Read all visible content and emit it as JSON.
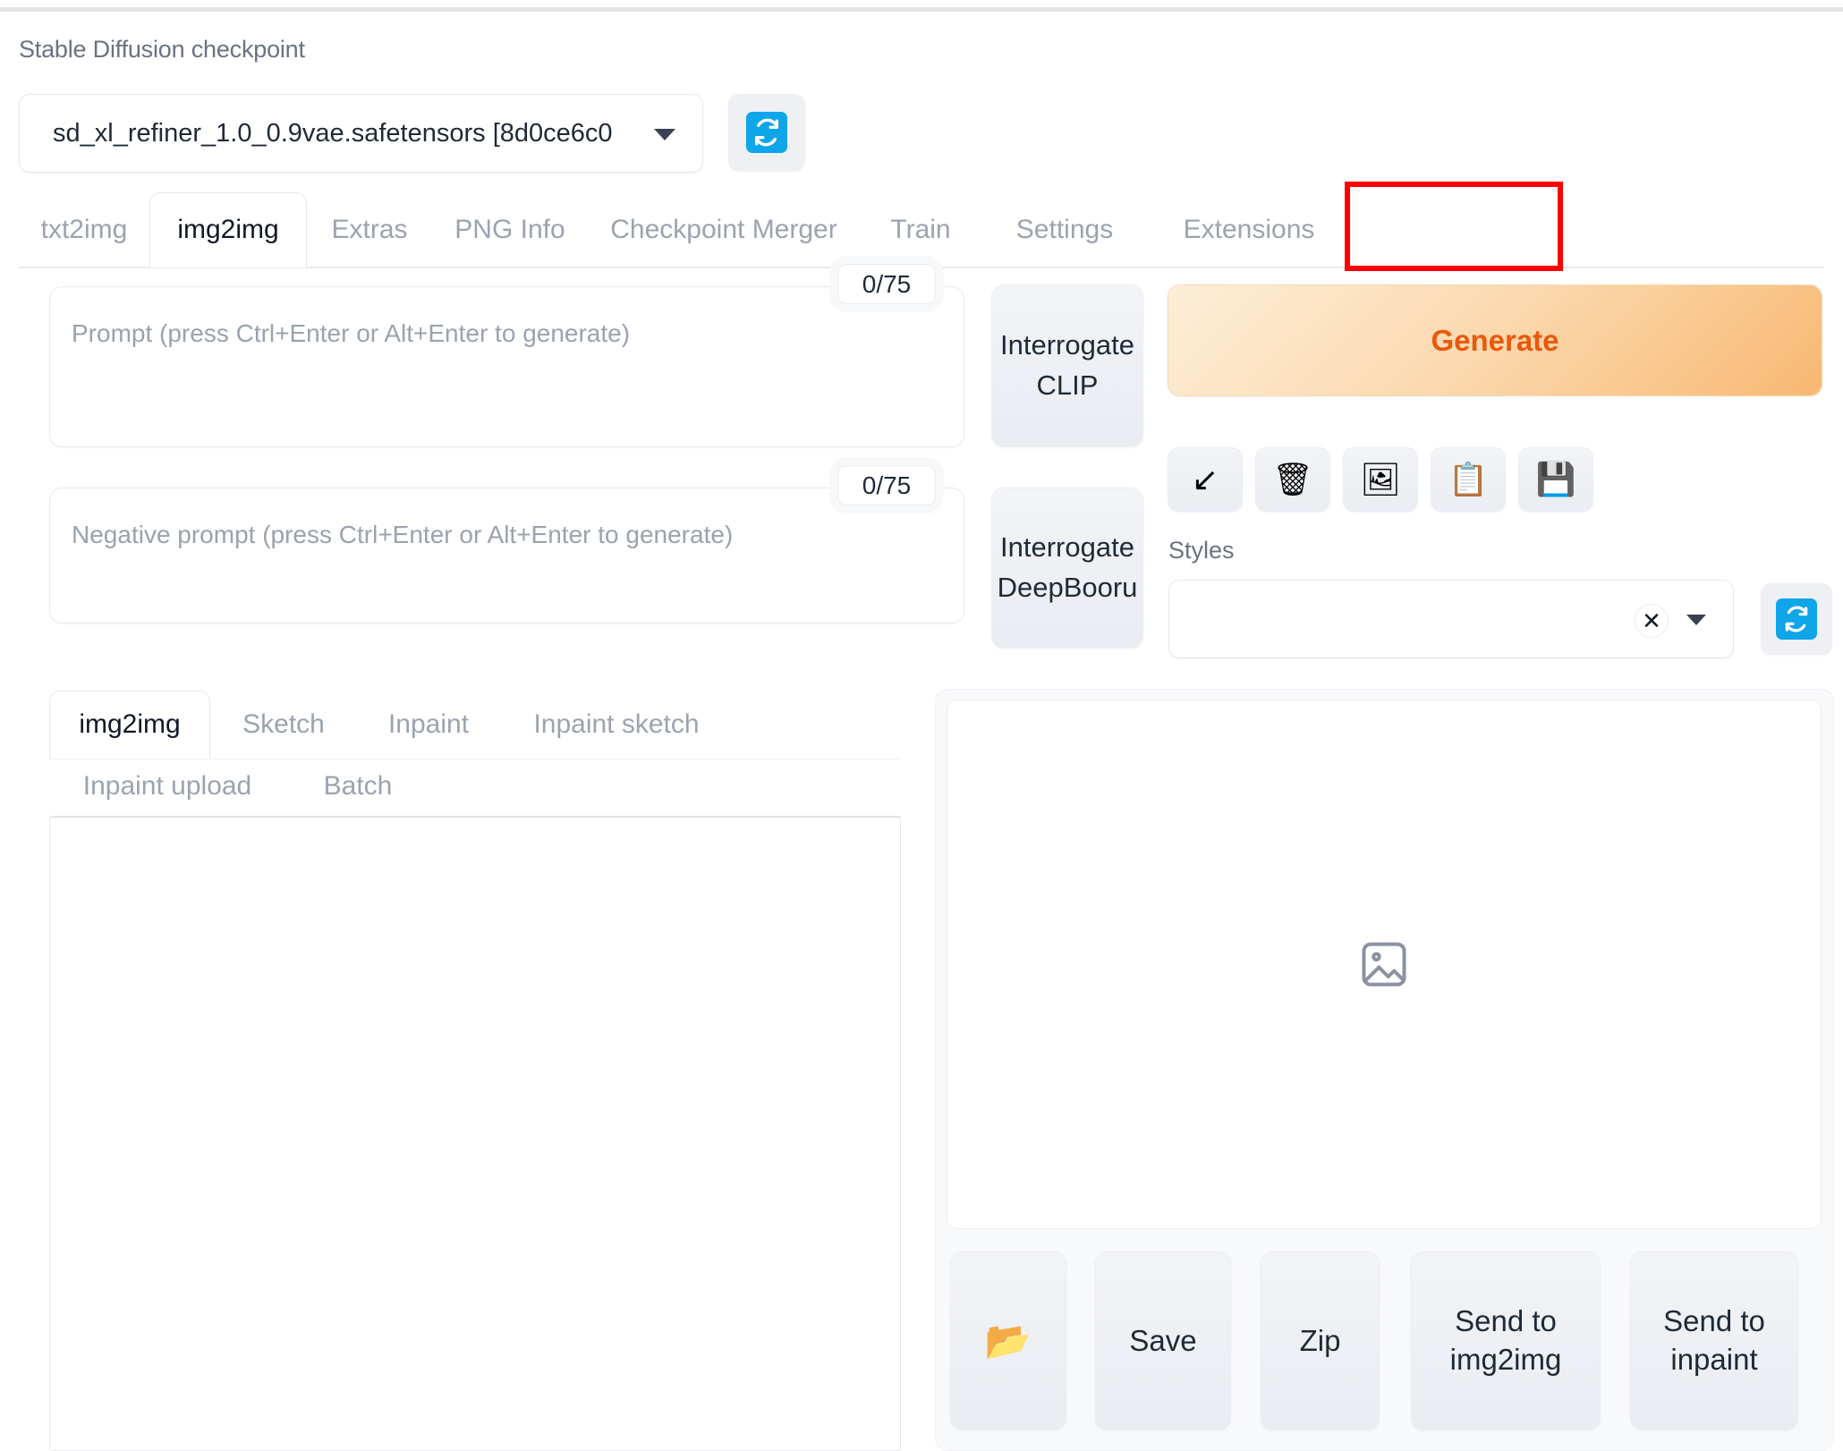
{
  "checkpoint": {
    "label": "Stable Diffusion checkpoint",
    "value": "sd_xl_refiner_1.0_0.9vae.safetensors [8d0ce6c0",
    "refresh_icon": "refresh-icon"
  },
  "tabs": [
    {
      "label": "txt2img",
      "active": false
    },
    {
      "label": "img2img",
      "active": true
    },
    {
      "label": "Extras",
      "active": false
    },
    {
      "label": "PNG Info",
      "active": false
    },
    {
      "label": "Checkpoint Merger",
      "active": false
    },
    {
      "label": "Train",
      "active": false
    },
    {
      "label": "Settings",
      "active": false
    },
    {
      "label": "Extensions",
      "active": false
    }
  ],
  "highlight": {
    "target": "Extensions",
    "color": "#ff0000"
  },
  "prompt": {
    "positive_placeholder": "Prompt (press Ctrl+Enter or Alt+Enter to generate)",
    "positive_value": "",
    "positive_counter": "0/75",
    "negative_placeholder": "Negative prompt (press Ctrl+Enter or Alt+Enter to generate)",
    "negative_value": "",
    "negative_counter": "0/75"
  },
  "interrogate": {
    "clip_line1": "Interrogate",
    "clip_line2": "CLIP",
    "deepbooru_line1": "Interrogate",
    "deepbooru_line2": "DeepBooru"
  },
  "generate": {
    "label": "Generate",
    "text_color": "#ea580c"
  },
  "tools": [
    {
      "name": "arrow-down-left-icon",
      "glyph": "↙"
    },
    {
      "name": "trash-icon",
      "glyph": "🗑"
    },
    {
      "name": "picture-icon",
      "glyph": "🖼"
    },
    {
      "name": "clipboard-icon",
      "glyph": "📋"
    },
    {
      "name": "floppy-save-icon",
      "glyph": "💾"
    }
  ],
  "styles": {
    "label": "Styles",
    "value": "",
    "clear_glyph": "✕",
    "refresh_icon": "refresh-icon"
  },
  "subtabs": [
    {
      "label": "img2img",
      "active": true
    },
    {
      "label": "Sketch",
      "active": false
    },
    {
      "label": "Inpaint",
      "active": false
    },
    {
      "label": "Inpaint sketch",
      "active": false
    },
    {
      "label": "Inpaint upload",
      "active": false
    },
    {
      "label": "Batch",
      "active": false
    }
  ],
  "gallery": {
    "placeholder_icon": "image-placeholder-icon",
    "buttons": [
      {
        "name": "open-folder-button",
        "label": "📂"
      },
      {
        "name": "save-button",
        "label": "Save"
      },
      {
        "name": "zip-button",
        "label": "Zip"
      },
      {
        "name": "send-to-img2img-button",
        "label": "Send to img2img"
      },
      {
        "name": "send-to-inpaint-button",
        "label": "Send to inpaint"
      }
    ]
  }
}
